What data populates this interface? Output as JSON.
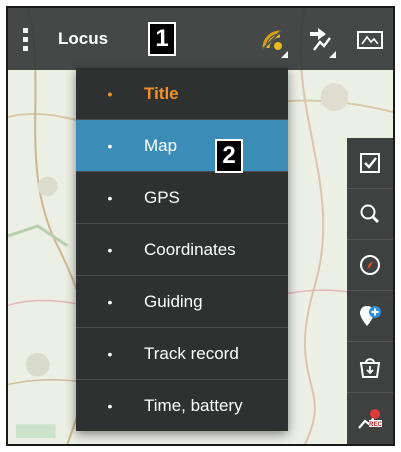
{
  "app": {
    "title": "Locus"
  },
  "annotations": {
    "badge_1": "1",
    "badge_2": "2"
  },
  "colors": {
    "title_accent": "#f0902a",
    "selected_bg": "#3b8db8",
    "menu_bg": "#2f3131",
    "toolbar_bg": "#363a38"
  },
  "toolbar": {
    "icons": [
      "overflow-menu-icon",
      "gps-signal-icon",
      "track-points-icon",
      "map-layers-icon"
    ]
  },
  "menu": {
    "items": [
      {
        "label": "Title",
        "bullet": "•",
        "kind": "title"
      },
      {
        "label": "Map",
        "bullet": "•",
        "kind": "selected"
      },
      {
        "label": "GPS",
        "bullet": "•",
        "kind": "normal"
      },
      {
        "label": "Coordinates",
        "bullet": "•",
        "kind": "normal"
      },
      {
        "label": "Guiding",
        "bullet": "•",
        "kind": "normal"
      },
      {
        "label": "Track record",
        "bullet": "•",
        "kind": "normal"
      },
      {
        "label": "Time, battery",
        "bullet": "•",
        "kind": "normal"
      }
    ]
  },
  "sidebar": {
    "icons": [
      "checkbox-icon",
      "search-icon",
      "compass-icon",
      "add-point-icon",
      "download-bag-icon",
      "track-rec-icon"
    ]
  }
}
